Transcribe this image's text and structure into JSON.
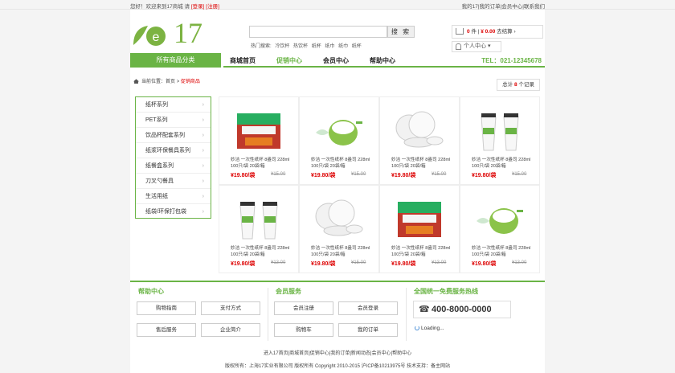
{
  "topbar": {
    "welcome": "您好！欢迎来到17商城 请",
    "login": "[登录]",
    "register": "[注册]",
    "links": [
      "我的17",
      "我的订单",
      "会员中心",
      "联系我们"
    ],
    "sep": "|"
  },
  "logo": {
    "text": "17",
    "letter": "e"
  },
  "search": {
    "placeholder": "",
    "button": "搜 索",
    "hot_label": "热门搜索:",
    "hot": [
      "冷饮杯",
      "热饮杯",
      "纸杯",
      "纸巾",
      "纸巾",
      "纸杯"
    ]
  },
  "cart": {
    "count": "0",
    "unit": "件",
    "sep": "|",
    "amount": "¥ 0.00",
    "checkout": "去结算 ›"
  },
  "personal": {
    "label": "个人中心 ▾"
  },
  "allcat": "所有商品分类",
  "nav": {
    "items": [
      "商城首页",
      "促销中心",
      "会员中心",
      "帮助中心"
    ],
    "tel": "TEL：021-12345678"
  },
  "breadcrumb": {
    "label": "当前位置：",
    "home": "首页",
    "sep": " > ",
    "current": "促销商品"
  },
  "total": {
    "prefix": "总计",
    "count": "8",
    "suffix": "个记录"
  },
  "sidebar": {
    "items": [
      "纸杯系列",
      "PET系列",
      "饮品杯配套系列",
      "纸浆环保餐具系列",
      "纸餐盒系列",
      "刀叉勺餐具",
      "生活用纸",
      "纸袋/环保打包袋"
    ],
    "chevron": "›"
  },
  "products": [
    {
      "name": "妙洁 一次性纸杯 8盎司 228ml 100只/袋 20袋/箱",
      "price": "¥19.80/袋",
      "old": "¥15.00",
      "kind": "box"
    },
    {
      "name": "妙洁 一次性纸杯 8盎司 228ml 100只/袋 20袋/箱",
      "price": "¥19.80/袋",
      "old": "¥15.00",
      "kind": "green"
    },
    {
      "name": "妙洁 一次性纸杯 8盎司 228ml 100只/袋 20袋/箱",
      "price": "¥19.80/袋",
      "old": "¥15.00",
      "kind": "plates"
    },
    {
      "name": "妙洁 一次性纸杯 8盎司 228ml 100只/袋 20袋/箱",
      "price": "¥19.80/袋",
      "old": "¥15.00",
      "kind": "cups"
    },
    {
      "name": "妙洁 一次性纸杯 8盎司 228ml 100只/袋 20袋/箱",
      "price": "¥19.80/袋",
      "old": "¥13.00",
      "kind": "cups"
    },
    {
      "name": "妙洁 一次性纸杯 8盎司 228ml 100只/袋 20袋/箱",
      "price": "¥19.80/袋",
      "old": "¥15.00",
      "kind": "plates"
    },
    {
      "name": "妙洁 一次性纸杯 8盎司 228ml 100只/袋 20袋/箱",
      "price": "¥19.80/袋",
      "old": "¥13.00",
      "kind": "box"
    },
    {
      "name": "妙洁 一次性纸杯 8盎司 228ml 100只/袋 20袋/箱",
      "price": "¥19.80/袋",
      "old": "¥13.00",
      "kind": "green"
    }
  ],
  "footer": {
    "help_title": "帮助中心",
    "help_buttons": [
      "购物指南",
      "支付方式",
      "售后服务",
      "企业简介"
    ],
    "member_title": "会员服务",
    "member_buttons": [
      "会员注册",
      "会员登录",
      "购物车",
      "我的订单"
    ],
    "hotline_title": "全国统一免费服务热线",
    "hotline": "400-8000-0000",
    "loading": "Loading..."
  },
  "bottom_links": [
    "进入17首页",
    "商城首页",
    "促销中心",
    "我的订单",
    "新闻动态",
    "会员中心",
    "帮助中心"
  ],
  "copyright": "版权所有：上海17实业有限公司 版权所有 Copyright 2010-2015 沪ICP备10213975号 技术支持：备主网站",
  "colors": {
    "brand_green": "#6ab445",
    "price_red": "#d00000"
  }
}
